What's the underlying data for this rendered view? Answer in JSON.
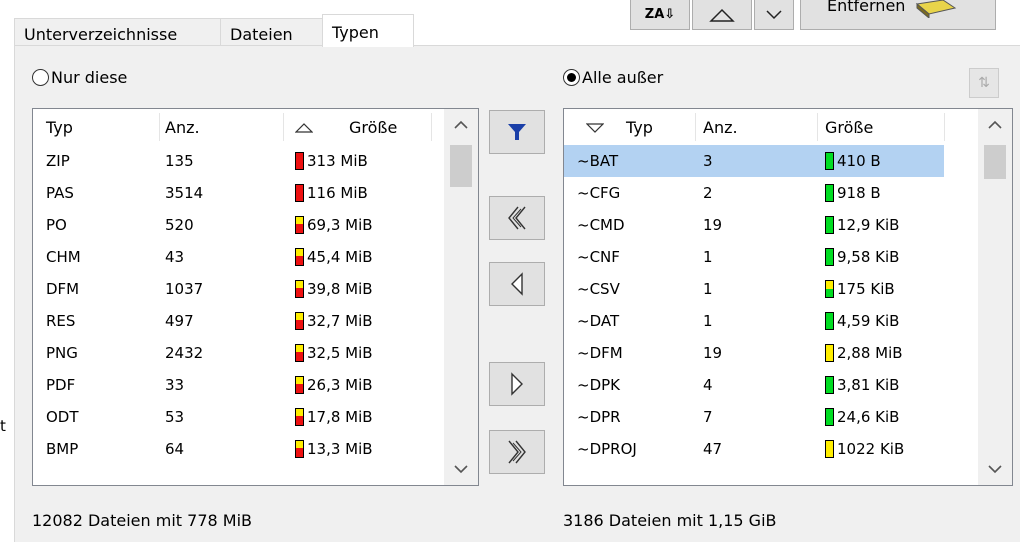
{
  "tabs": [
    "Unterverzeichnisse",
    "Dateien",
    "Typen"
  ],
  "toolbar": {
    "remove_label": "Entfernen"
  },
  "left": {
    "radio_label": "Nur diese",
    "headers": {
      "type": "Typ",
      "count": "Anz.",
      "size": "Größe"
    },
    "rows": [
      {
        "type": "ZIP",
        "count": "135",
        "size": "313 MiB",
        "level": "red"
      },
      {
        "type": "PAS",
        "count": "3514",
        "size": "116 MiB",
        "level": "red"
      },
      {
        "type": "PO",
        "count": "520",
        "size": "69,3 MiB",
        "level": "redyellow"
      },
      {
        "type": "CHM",
        "count": "43",
        "size": "45,4 MiB",
        "level": "redyellow"
      },
      {
        "type": "DFM",
        "count": "1037",
        "size": "39,8 MiB",
        "level": "redyellow"
      },
      {
        "type": "RES",
        "count": "497",
        "size": "32,7 MiB",
        "level": "redyellow"
      },
      {
        "type": "PNG",
        "count": "2432",
        "size": "32,5 MiB",
        "level": "redyellow"
      },
      {
        "type": "PDF",
        "count": "33",
        "size": "26,3 MiB",
        "level": "redyellow"
      },
      {
        "type": "ODT",
        "count": "53",
        "size": "17,8 MiB",
        "level": "redyellow"
      },
      {
        "type": "BMP",
        "count": "64",
        "size": "13,3 MiB",
        "level": "redyellow"
      }
    ],
    "footer": "12082 Dateien mit 778 MiB"
  },
  "right": {
    "radio_label": "Alle außer",
    "headers": {
      "type": "Typ",
      "count": "Anz.",
      "size": "Größe"
    },
    "rows": [
      {
        "type": "~BAT",
        "count": "3",
        "size": "410 B",
        "level": "green"
      },
      {
        "type": "~CFG",
        "count": "2",
        "size": "918 B",
        "level": "green"
      },
      {
        "type": "~CMD",
        "count": "19",
        "size": "12,9 KiB",
        "level": "green"
      },
      {
        "type": "~CNF",
        "count": "1",
        "size": "9,58 KiB",
        "level": "green"
      },
      {
        "type": "~CSV",
        "count": "1",
        "size": "175 KiB",
        "level": "greenyellow"
      },
      {
        "type": "~DAT",
        "count": "1",
        "size": "4,59 KiB",
        "level": "green"
      },
      {
        "type": "~DFM",
        "count": "19",
        "size": "2,88 MiB",
        "level": "yellow"
      },
      {
        "type": "~DPK",
        "count": "4",
        "size": "3,81 KiB",
        "level": "green"
      },
      {
        "type": "~DPR",
        "count": "7",
        "size": "24,6 KiB",
        "level": "green"
      },
      {
        "type": "~DPROJ",
        "count": "47",
        "size": "1022 KiB",
        "level": "yellow"
      }
    ],
    "footer": "3186 Dateien mit 1,15 GiB"
  },
  "edge_text": "t",
  "colors": {
    "red": "#ee1111",
    "yellow": "#ffee00",
    "green": "#00dd22",
    "selection": "#b3d2f2",
    "filter_icon": "#1a3fa8"
  }
}
